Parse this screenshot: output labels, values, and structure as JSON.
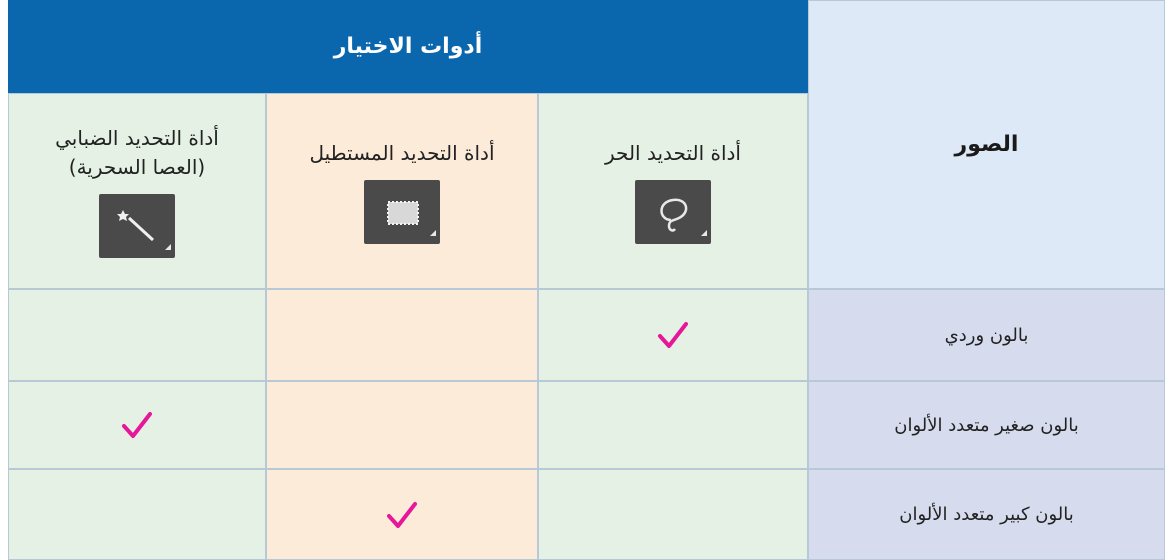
{
  "table": {
    "header_tools": "أدوات الاختيار",
    "header_images": "الصور",
    "tools": [
      {
        "label": "أداة التحديد الحر",
        "icon": "lasso-icon"
      },
      {
        "label": "أداة التحديد المستطيل",
        "icon": "rectangle-marquee-icon"
      },
      {
        "label_line1": "أداة التحديد الضبابي",
        "label_line2": "(العصا السحرية)",
        "icon": "magic-wand-icon"
      }
    ],
    "rows": [
      {
        "label": "بالون وردي",
        "checked_tool": "أداة التحديد الحر"
      },
      {
        "label": "بالون صغير متعدد الألوان",
        "checked_tool": "أداة التحديد الضبابي"
      },
      {
        "label": "بالون كبير متعدد الألوان",
        "checked_tool": "أداة التحديد المستطيل"
      }
    ],
    "check_symbol": "✓",
    "check_color": "#e6179a",
    "colors": {
      "header": "#0b67ad",
      "green": "#e4f1e4",
      "peach": "#fcebd9",
      "row_label": "#d6dcee",
      "images_header": "#dde9f6"
    }
  }
}
